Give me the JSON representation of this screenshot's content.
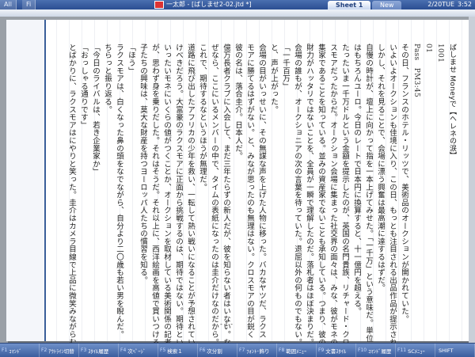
{
  "app": {
    "left_tabs": [
      "All",
      "Fi"
    ],
    "document_title": "一太郎 - [ばしませ2-02.jtd *]",
    "sheet_tabs": [
      {
        "label": "Sheet 1"
      },
      {
        "label": "New"
      }
    ],
    "clock": {
      "date": "2/20TUE",
      "time": "3:52"
    }
  },
  "document": {
    "columns": [
      {
        "text": "ばしませ Moneyで【ヘレネの涙】",
        "kind": "title"
      },
      {
        "text": "1001",
        "kind": "small"
      },
      {
        "text": "01",
        "kind": "small"
      },
      {
        "text": "Pass　PM3:45",
        "kind": "small"
      },
      {
        "text": "その日、フランスのホテル・リッツで、美術品のオークションが開かれていた。",
        "kind": "body"
      },
      {
        "text": "いよいよオークションも佳境に入り、この日、もっとも注目される出品作品が提示され",
        "kind": "body"
      },
      {
        "text": "しかし、それを見ることで、会場に漂う興奮は最高潮に達するはずだ。",
        "kind": "body"
      },
      {
        "text": "自慢の時計が、壇上に向かって指を一本上げてみせた。「一千万」という意味だ。単位",
        "kind": "body"
      },
      {
        "text": "はもちろんユーロ。今日のレートで日本円に換算すると、十一億円を超える。",
        "kind": "body"
      },
      {
        "text": "たったいま一千万ドルという金額を提示したのが、英国の名門貴族、リチャード・クロ",
        "kind": "body"
      },
      {
        "text": "スモアだったからだ。オークション会場に集まった社交界の面々は、みな、彼がモネの収",
        "kind": "body"
      },
      {
        "text": "集家であることを知っている。並みの資産家でないことも承知している。つまり、彼の",
        "kind": "body"
      },
      {
        "text": "財力がハッタリではないことを、全員が一瞬で理解したのだ。落札者はほぼ決まりだ。",
        "kind": "body"
      },
      {
        "text": "会場の誰もが、オークショニアの次の言葉を待っていた。退屈以外の何ものでもない。",
        "kind": "body"
      },
      {
        "text": "「一千百万」",
        "kind": "body"
      },
      {
        "text": "と、声が上がった。",
        "kind": "body"
      },
      {
        "text": "会場の目がいっせいに、その無謀な声を上げた人物に移った。バカなヤツだ、ラクス",
        "kind": "body"
      },
      {
        "text": "モアに勝てるはずがない。と、みなが思ったのも無理はない。クロスモアの目が鋭く",
        "kind": "body"
      },
      {
        "text": "彼の名は、落合圭介。日本人だ。",
        "kind": "body"
      },
      {
        "text": "億万長者クラブに入会して、まだ三年たらずの新人だが、彼を知らない者はいない。な",
        "kind": "body"
      },
      {
        "text": "ぜなら、ここにいるメンバーの中で、タイムの表紙になったのは圭介だけなのだから。",
        "kind": "body"
      },
      {
        "text": "これで、期待するなというほうが無理だ。",
        "kind": "body"
      },
      {
        "text": "道路に飛び出したアフリカの少年を救い、一転して熱い戦いになることが予想されてい",
        "kind": "body"
      },
      {
        "text": "けべきだろう。大富豪のラクスモアに正面から挑戦するのは、期待ではない。期待とい",
        "kind": "body"
      },
      {
        "text": "いったいモネにいくらの値がつくことか、オークションを取材している美術関係の記者",
        "kind": "body"
      },
      {
        "text": "が、思わず身を乗りだした。それはそうだ。それ以上に、西洋絵画を高値で買いつける",
        "kind": "body"
      },
      {
        "text": "子たちの興味は、莫大な財産を持つヨーロッパ人たちの慣習を知る。",
        "kind": "body"
      },
      {
        "text": "「ほう」",
        "kind": "body"
      },
      {
        "text": "ラクスモアは、白くなった鼻の頭をなでながら、自分より二〇歳も若い男を睨んだ。",
        "kind": "body"
      },
      {
        "text": "ちらっと振り返る。",
        "kind": "body"
      },
      {
        "text": "「今日のライバルは、若き企業家か」",
        "kind": "body"
      },
      {
        "text": "「おっしゃる通りです」",
        "kind": "body"
      },
      {
        "text": "とばかりに、ラクスモアはにやりと笑った。圭介はカメラ目線で上品に微笑みながらむしろ。",
        "kind": "body"
      }
    ],
    "page_number": "- 1 -"
  },
  "function_keys": [
    {
      "no": "F1",
      "label": "ｺﾏﾝﾄﾞ"
    },
    {
      "no": "F2",
      "label": "ｱｳﾄﾗｲﾝ切替"
    },
    {
      "no": "F3",
      "label": "ｽﾀｲﾙ履歴"
    },
    {
      "no": "F4",
      "label": "次ﾍﾟｰｼﾞ"
    },
    {
      "no": "F5",
      "label": "検索１"
    },
    {
      "no": "F6",
      "label": "次分割"
    },
    {
      "no": "F7",
      "label": "ﾌｫﾝﾄ･飾り"
    },
    {
      "no": "F8",
      "label": "範囲ﾒﾆｭｰ"
    },
    {
      "no": "F9",
      "label": "文書ｽﾀｲﾙ"
    },
    {
      "no": "F10",
      "label": "ｺﾏﾝﾄﾞ履歴"
    },
    {
      "no": "F11",
      "label": "SCﾒﾆｭｰ"
    },
    {
      "no": "",
      "label": "SHIFT"
    }
  ]
}
